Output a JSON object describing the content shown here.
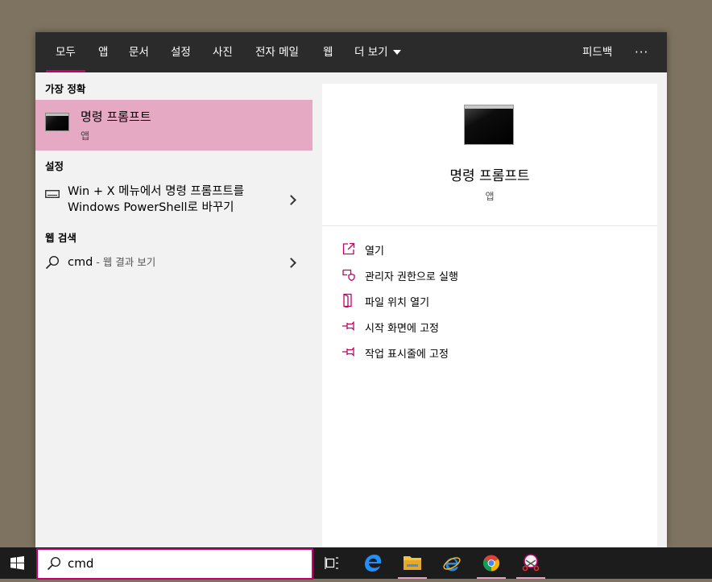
{
  "tabs": [
    {
      "label": "모두",
      "active": true
    },
    {
      "label": "앱"
    },
    {
      "label": "문서"
    },
    {
      "label": "설정"
    },
    {
      "label": "사진"
    },
    {
      "label": "전자 메일"
    },
    {
      "label": "웹"
    },
    {
      "label": "더 보기"
    }
  ],
  "header_right": {
    "feedback": "피드백",
    "more": "···"
  },
  "best_match": {
    "section": "가장 정확",
    "title": "명령 프롬프트",
    "subtitle": "앱"
  },
  "settings": {
    "section": "설정",
    "line1": "Win + X 메뉴에서 명령 프롬프트를",
    "line2": "Windows PowerShell로 바꾸기"
  },
  "web": {
    "section": "웹 검색",
    "query": "cmd",
    "suffix": " - 웹 결과 보기"
  },
  "preview": {
    "title": "명령 프롬프트",
    "subtitle": "앱"
  },
  "actions": [
    {
      "label": "열기",
      "icon": "open-icon"
    },
    {
      "label": "관리자 권한으로 실행",
      "icon": "admin-shield-icon"
    },
    {
      "label": "파일 위치 열기",
      "icon": "file-location-icon"
    },
    {
      "label": "시작 화면에 고정",
      "icon": "pin-icon"
    },
    {
      "label": "작업 표시줄에 고정",
      "icon": "pin-icon"
    }
  ],
  "search": {
    "value": "cmd"
  },
  "colors": {
    "accent": "#c3006b",
    "highlight": "#e5a9c4",
    "tabbar": "#2b2b2b",
    "taskbar": "#1c1c1c"
  }
}
